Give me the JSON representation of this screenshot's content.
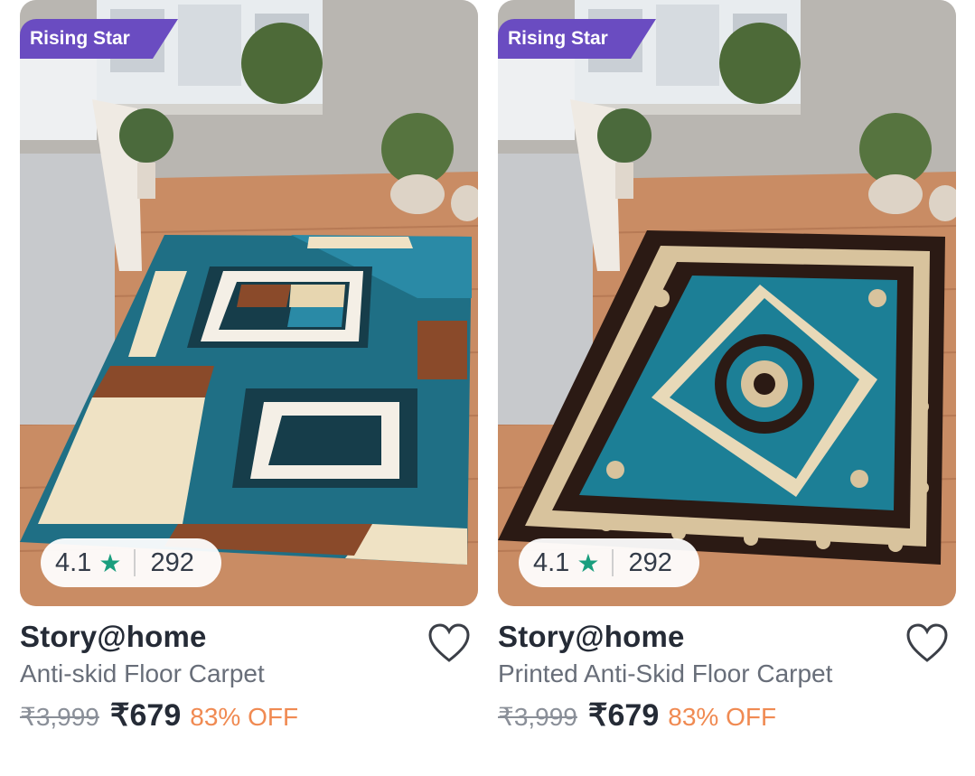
{
  "products": [
    {
      "badge": "Rising Star",
      "rating": "4.1",
      "rating_star": "★",
      "rating_count": "292",
      "brand": "Story@home",
      "title": "Anti-skid Floor Carpet",
      "mrp": "₹3,999",
      "price": "₹679",
      "discount": "83% OFF",
      "wishlist_icon": "heart-outline-icon"
    },
    {
      "badge": "Rising Star",
      "rating": "4.1",
      "rating_star": "★",
      "rating_count": "292",
      "brand": "Story@home",
      "title": "Printed Anti-Skid Floor Carpet",
      "mrp": "₹3,999",
      "price": "₹679",
      "discount": "83% OFF",
      "wishlist_icon": "heart-outline-icon"
    }
  ],
  "colors": {
    "badge_bg": "#6a4cc1",
    "rating_star": "#1a9e7e",
    "discount": "#f08a52",
    "brand_text": "#252b36"
  }
}
